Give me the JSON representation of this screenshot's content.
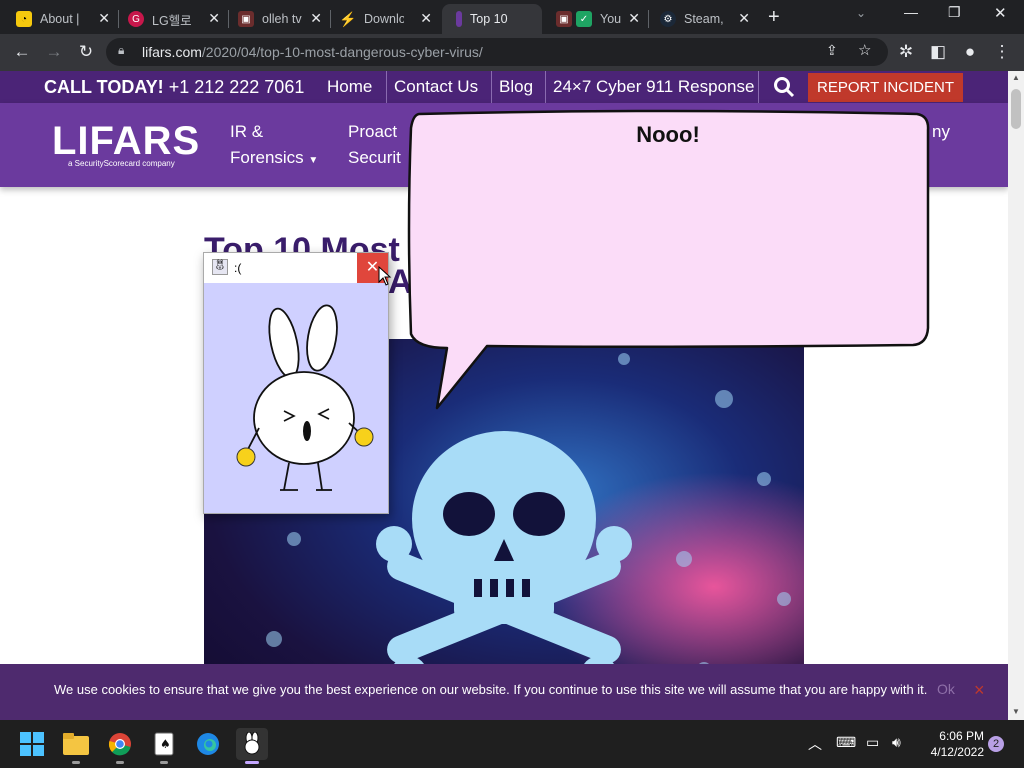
{
  "browser": {
    "tabs": [
      {
        "title": "About |",
        "icon": "snail-icon"
      },
      {
        "title": "LG헬로",
        "icon": "lg-icon"
      },
      {
        "title": "olleh tv",
        "icon": "tv-icon"
      },
      {
        "title": "Downlo",
        "icon": "bolt-icon"
      },
      {
        "title": "Top 10",
        "icon": "lifars-icon"
      },
      {
        "title": "You",
        "icon": "youtube-icon"
      },
      {
        "title": "Steam,",
        "icon": "steam-icon"
      }
    ],
    "new_tab": "+",
    "url_host": "lifars.com",
    "url_path": "/2020/04/top-10-most-dangerous-cyber-virus/"
  },
  "site": {
    "call_label": "CALL TODAY!",
    "call_number": "+1 212 222 7061",
    "top_nav": [
      "Home",
      "Contact Us",
      "Blog",
      "24×7 Cyber 911 Response"
    ],
    "report_button": "REPORT INCIDENT",
    "logo": "LIFARS",
    "logo_sub": "a SecurityScorecard company",
    "nav": {
      "ir_line1": "IR &",
      "ir_line2": "Forensics",
      "proactive_line1": "Proact",
      "proactive_line2": "Securit",
      "company": "ny"
    },
    "article_title": "Top 10 Most",
    "article_title_tail": "A"
  },
  "cookie": {
    "message": "We use cookies to ensure that we give you the best experience on our website. If you continue to use this site we will assume that you are happy with it.",
    "ok": "Ok",
    "close": "×"
  },
  "popup": {
    "title": ":(",
    "close": "✕"
  },
  "bubble": {
    "text": "Nooo!"
  },
  "taskbar": {
    "time": "6:06 PM",
    "date": "4/12/2022",
    "notifications": "2"
  },
  "colors": {
    "site_purple": "#6b3a9e",
    "topbar_purple": "#4b2477",
    "report_red": "#c0392b",
    "bubble_fill": "#fbdcf8"
  }
}
